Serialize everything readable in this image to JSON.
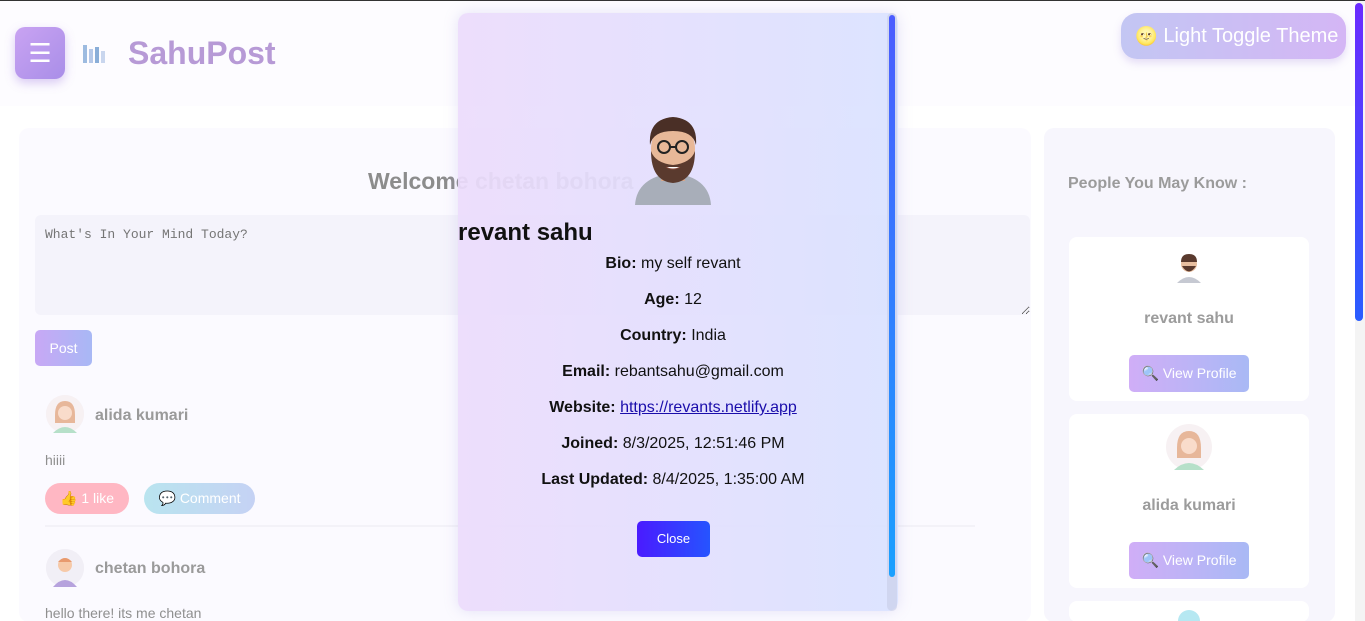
{
  "header": {
    "menu_icon": "☰",
    "logo_text": "SahuPost",
    "theme_toggle_label": "Light Toggle Theme",
    "theme_icon": "moon-icon"
  },
  "feed": {
    "welcome": "Welcome chetan bohora",
    "post_placeholder": "What's In Your Mind Today?",
    "post_button": "Post",
    "posts": [
      {
        "author": "alida kumari",
        "text": "hiiii",
        "like_label": "1 like",
        "comment_label": "Comment"
      },
      {
        "author": "chetan bohora",
        "text": "hello there! its me chetan"
      }
    ]
  },
  "sidebar": {
    "title": "People You May Know :",
    "people": [
      {
        "name": "revant sahu",
        "button": "View Profile"
      },
      {
        "name": "alida kumari",
        "button": "View Profile"
      }
    ]
  },
  "modal": {
    "name": "revant sahu",
    "bio_label": "Bio:",
    "bio": "my self revant",
    "age_label": "Age:",
    "age": "12",
    "country_label": "Country:",
    "country": "India",
    "email_label": "Email:",
    "email": "rebantsahu@gmail.com",
    "website_label": "Website:",
    "website": "https://revants.netlify.app",
    "joined_label": "Joined:",
    "joined": "8/3/2025, 12:51:46 PM",
    "updated_label": "Last Updated:",
    "updated": "8/4/2025, 1:35:00 AM",
    "close_button": "Close"
  },
  "colors": {
    "accent": "#b79ad6",
    "modal_button": "#3a2bff",
    "scrollbar": "#5b3bff"
  }
}
